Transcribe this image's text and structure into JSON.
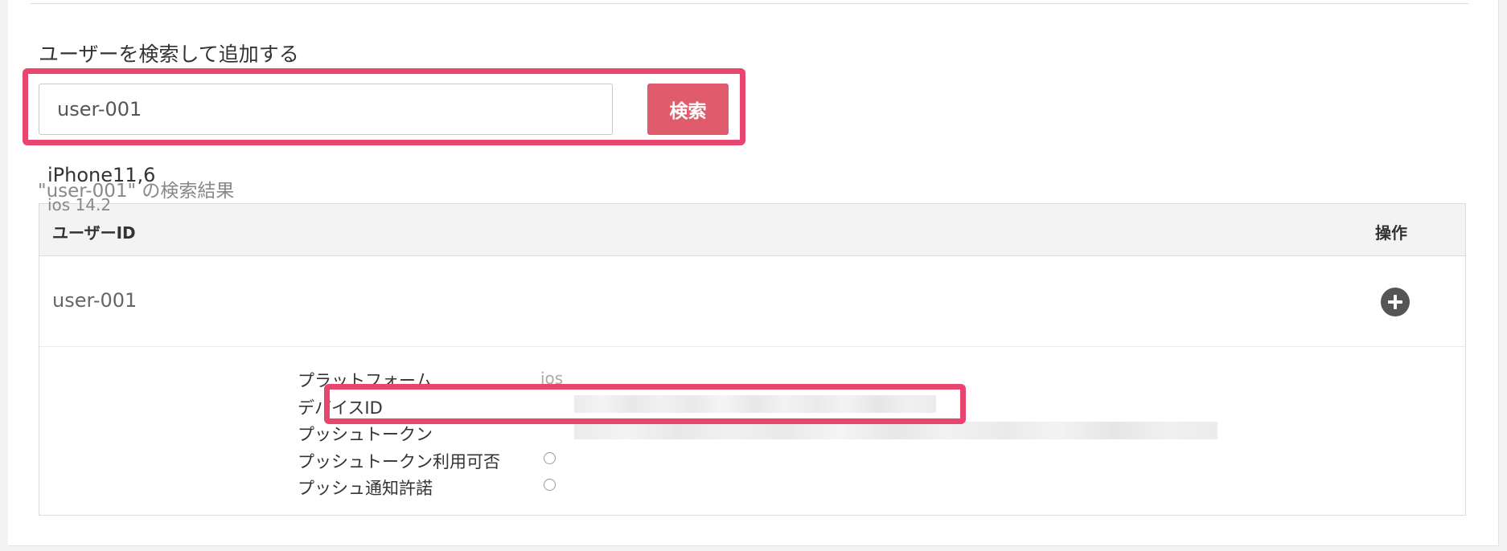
{
  "section": {
    "title": "ユーザーを検索して追加する"
  },
  "search": {
    "value": "user-001",
    "button_label": "検索"
  },
  "results": {
    "caption": "\"user-001\" の検索結果",
    "columns": [
      "ユーザーID",
      "操作"
    ],
    "rows": [
      {
        "user_id": "user-001",
        "device": {
          "name": "iPhone11,6",
          "os": "ios 14.2",
          "properties": [
            {
              "label": "プラットフォーム",
              "value": "ios"
            },
            {
              "label": "デバイスID",
              "value": ""
            },
            {
              "label": "プッシュトークン",
              "value": ""
            },
            {
              "label": "プッシュトークン利用可否",
              "value": ""
            },
            {
              "label": "プッシュ通知許諾",
              "value": ""
            }
          ]
        }
      }
    ]
  },
  "colors": {
    "accent": "#e05c6c",
    "highlight": "#e8466e",
    "header_bg": "#f3f3f3"
  }
}
